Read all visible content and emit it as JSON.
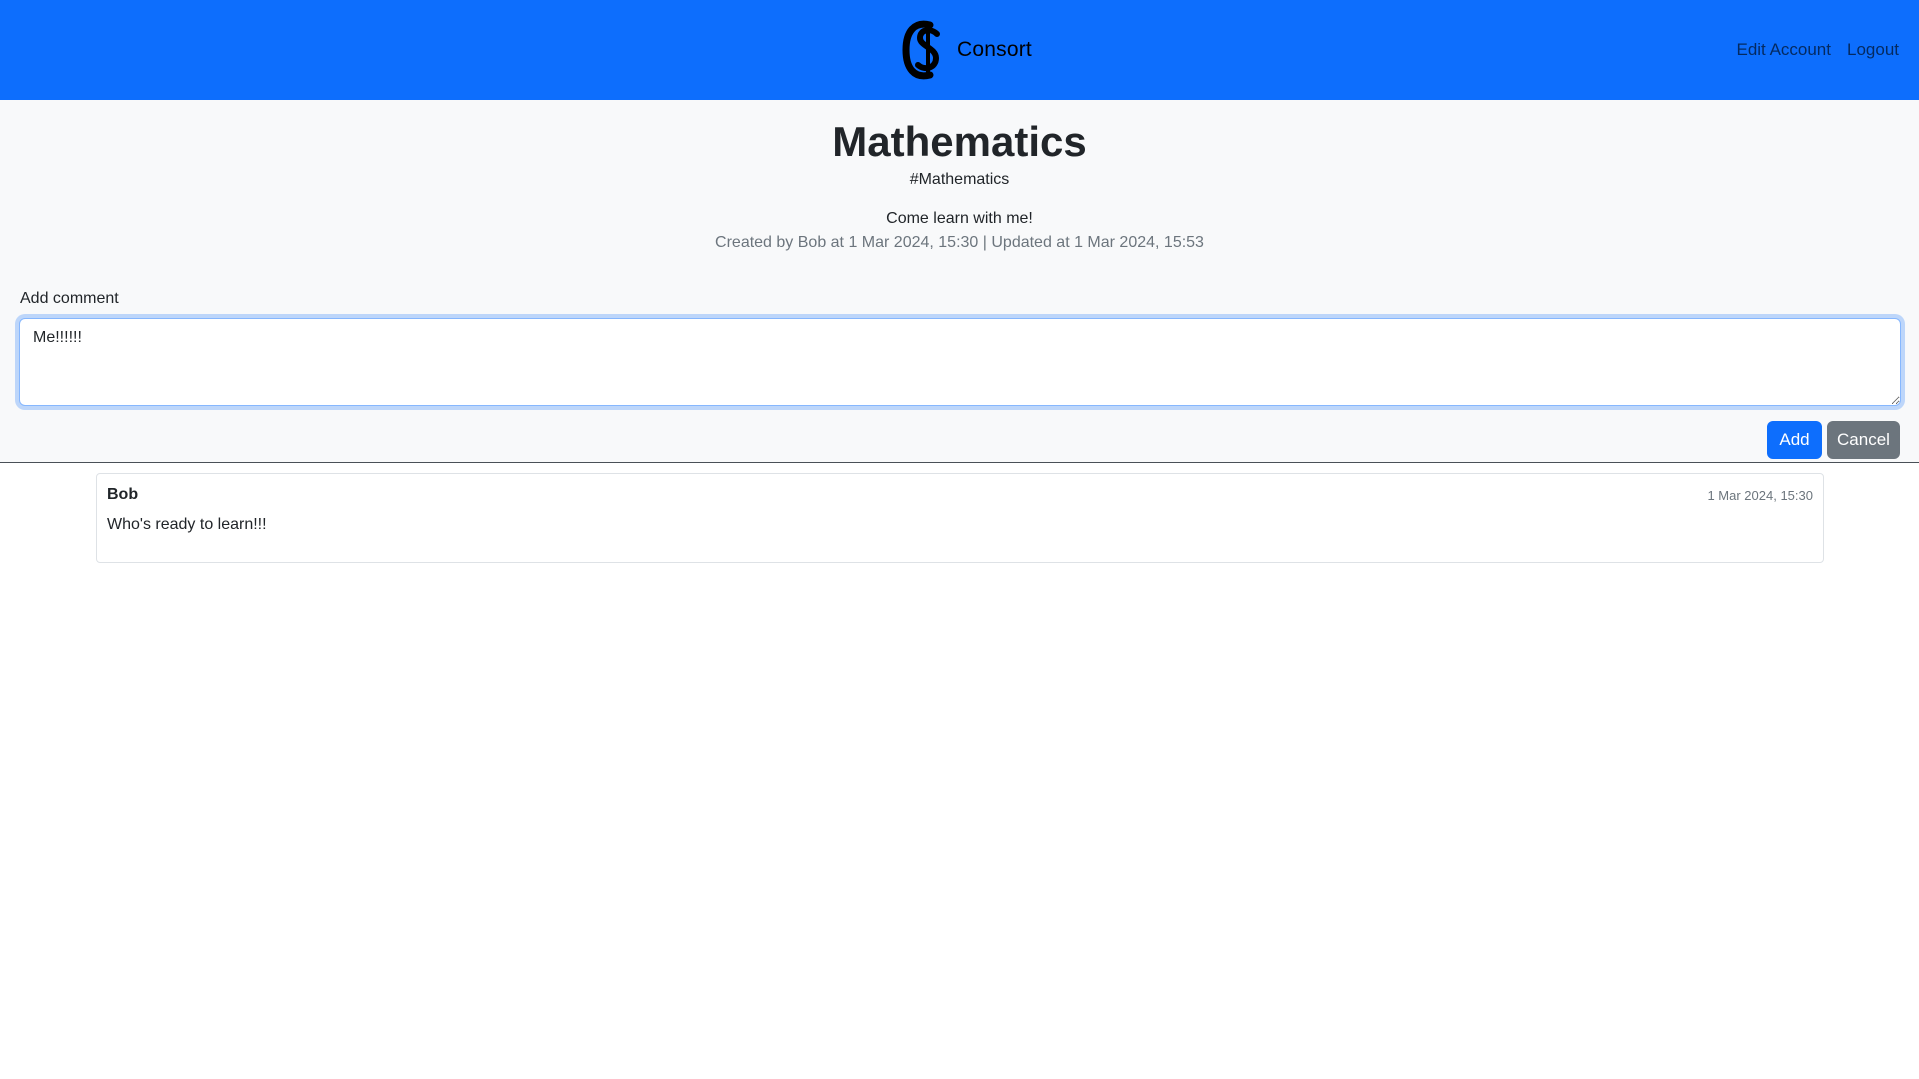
{
  "navbar": {
    "brand": "Consort",
    "logo_icon": "consort-cs-logo-icon",
    "links": [
      "Edit Account",
      "Logout"
    ],
    "background": "#0d6efd"
  },
  "channel": {
    "title": "Mathematics",
    "hashtag": "#Mathematics",
    "description": "Come learn with me!",
    "meta": "Created by Bob at 1 Mar 2024, 15:30 | Updated at 1 Mar 2024, 15:53"
  },
  "comment_form": {
    "label": "Add comment",
    "value": "Me!!!!!!",
    "add_label": "Add",
    "cancel_label": "Cancel"
  },
  "comments": [
    {
      "author": "Bob",
      "timestamp": "1 Mar 2024, 15:30",
      "text": "Who's ready to learn!!!"
    }
  ],
  "colors": {
    "primary": "#0d6efd",
    "secondary": "#6c757d",
    "muted_text": "#6c757d"
  }
}
